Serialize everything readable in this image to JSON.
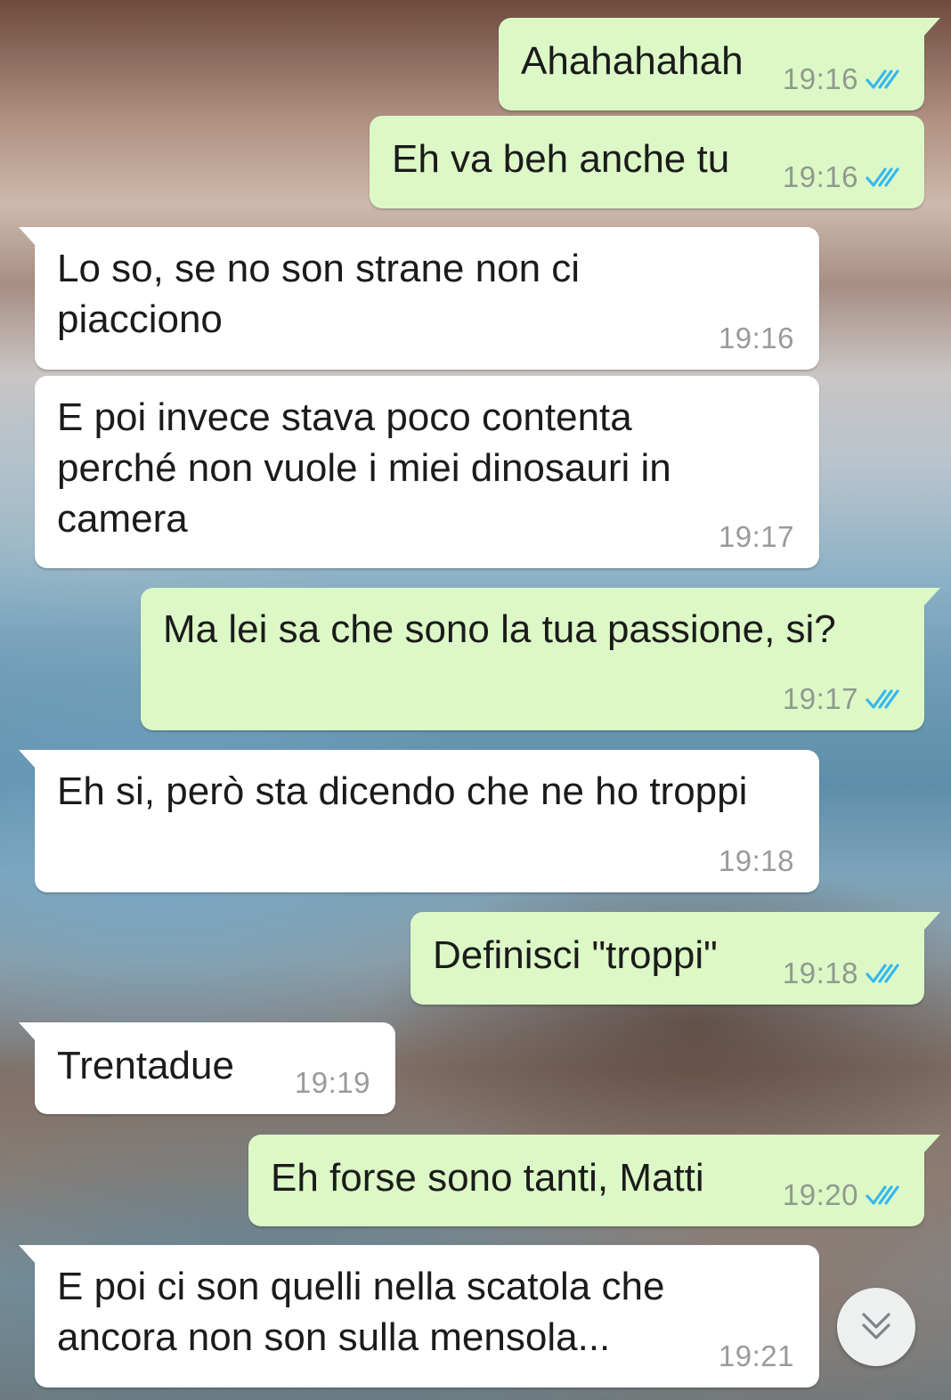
{
  "colors": {
    "outgoing_bubble": "#dcf8c6",
    "incoming_bubble": "#ffffff",
    "read_ticks": "#34b7f1"
  },
  "messages": [
    {
      "direction": "out",
      "text": "Ahahahahah",
      "time": "19:16",
      "status": "read"
    },
    {
      "direction": "out",
      "text": "Eh va beh anche tu",
      "time": "19:16",
      "status": "read"
    },
    {
      "direction": "in",
      "text": "Lo so, se no son strane non ci\npiacciono",
      "time": "19:16"
    },
    {
      "direction": "in",
      "text": "E poi invece stava poco contenta\nperché non vuole i miei dinosauri in\ncamera",
      "time": "19:17"
    },
    {
      "direction": "out",
      "text": "Ma lei sa che sono la tua passione, si?",
      "time": "19:17",
      "status": "read"
    },
    {
      "direction": "in",
      "text": "Eh si, però sta dicendo che ne ho troppi",
      "time": "19:18"
    },
    {
      "direction": "out",
      "text": "Definisci \"troppi\"",
      "time": "19:18",
      "status": "read"
    },
    {
      "direction": "in",
      "text": "Trentadue",
      "time": "19:19"
    },
    {
      "direction": "out",
      "text": "Eh forse sono tanti, Matti",
      "time": "19:20",
      "status": "read"
    },
    {
      "direction": "in",
      "text": "E poi ci son quelli nella scatola che\nancora non son sulla mensola...",
      "time": "19:21"
    }
  ],
  "scroll_button_icon": "double-chevron-down-icon"
}
